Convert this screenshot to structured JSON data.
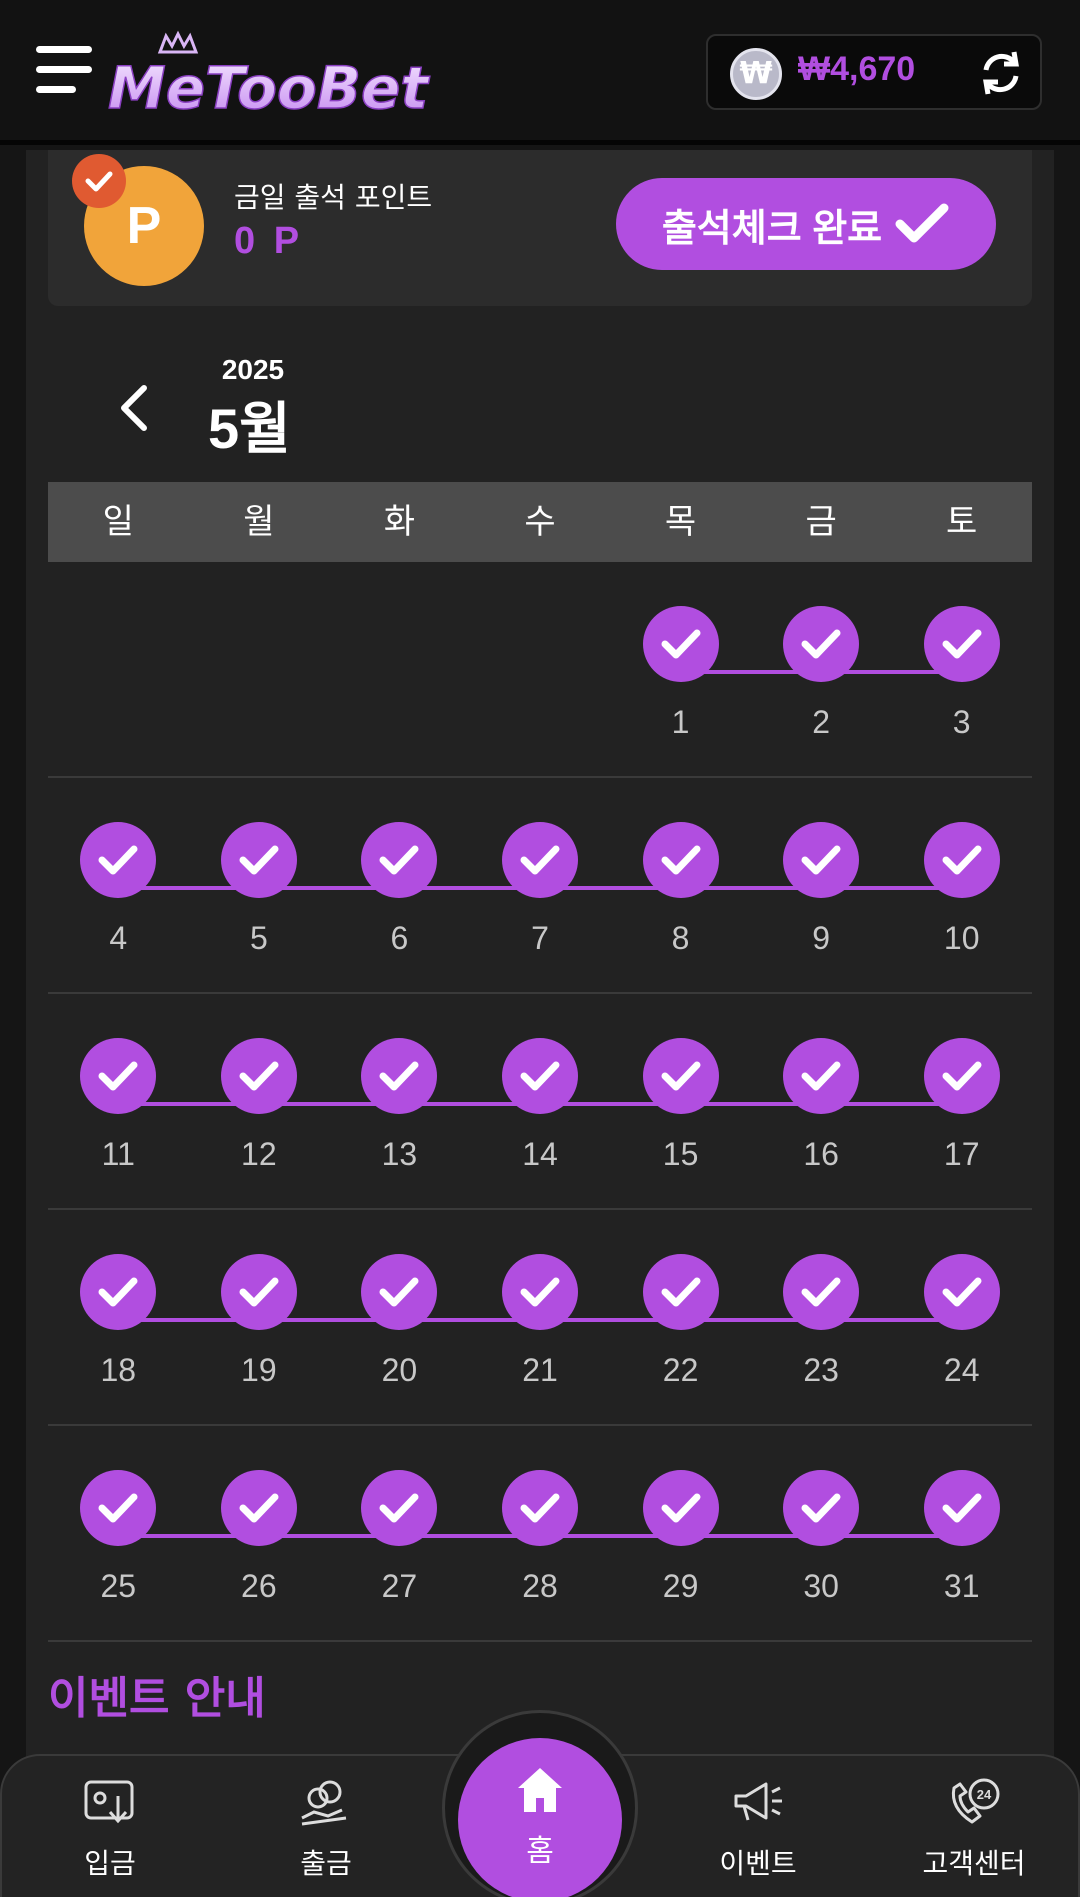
{
  "header": {
    "logo_text": "MeTooBet",
    "balance": "₩4,670",
    "coin_symbol": "₩"
  },
  "points": {
    "badge_letter": "P",
    "label": "금일 출석 포인트",
    "value": "0 P",
    "attend_button_label": "출석체크 완료"
  },
  "calendar": {
    "year": "2025",
    "month": "5월",
    "weekdays": [
      "일",
      "월",
      "화",
      "수",
      "목",
      "금",
      "토"
    ],
    "weeks": [
      [
        "",
        "",
        "",
        "",
        "1",
        "2",
        "3"
      ],
      [
        "4",
        "5",
        "6",
        "7",
        "8",
        "9",
        "10"
      ],
      [
        "11",
        "12",
        "13",
        "14",
        "15",
        "16",
        "17"
      ],
      [
        "18",
        "19",
        "20",
        "21",
        "22",
        "23",
        "24"
      ],
      [
        "25",
        "26",
        "27",
        "28",
        "29",
        "30",
        "31"
      ]
    ],
    "checked": true
  },
  "event_section": {
    "title": "이벤트 안내"
  },
  "bottom_nav": {
    "deposit": "입금",
    "withdraw": "출금",
    "home": "홈",
    "event": "이벤트",
    "support": "고객센터"
  },
  "colors": {
    "accent": "#b14ee0",
    "badge": "#e05a31",
    "points_circle": "#f1a43a"
  }
}
